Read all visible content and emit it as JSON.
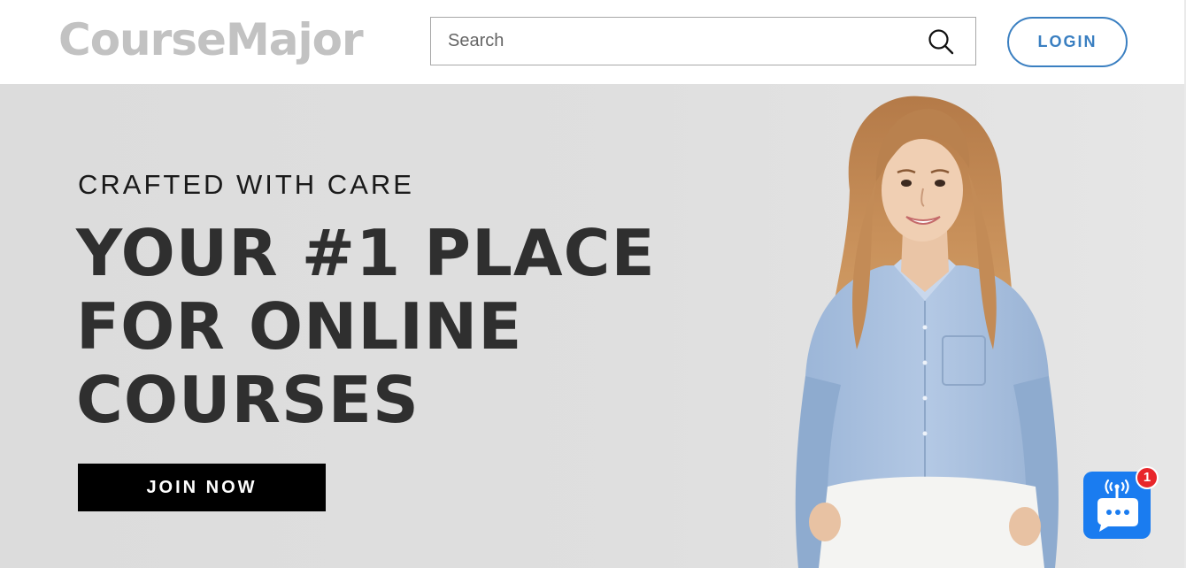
{
  "header": {
    "logo_text": "CourseMajor",
    "search": {
      "placeholder": "Search",
      "value": ""
    },
    "login_label": "LOGIN"
  },
  "hero": {
    "subtitle": "CRAFTED WITH CARE",
    "title_lines": [
      "YOUR #1 PLACE",
      "FOR ONLINE",
      "COURSES"
    ],
    "cta_label": "JOIN NOW"
  },
  "chat_widget": {
    "badge_count": "1"
  },
  "colors": {
    "brand_logo": "#c2c2c2",
    "accent_blue": "#3a7fc1",
    "chat_blue": "#1a7cf0",
    "badge_red": "#e8262b",
    "hero_bg": "#dcdcdc",
    "cta_bg": "#000000"
  },
  "icons": {
    "search": "search-icon",
    "chat": "chat-bubble-icon",
    "signal": "signal-broadcast-icon"
  }
}
